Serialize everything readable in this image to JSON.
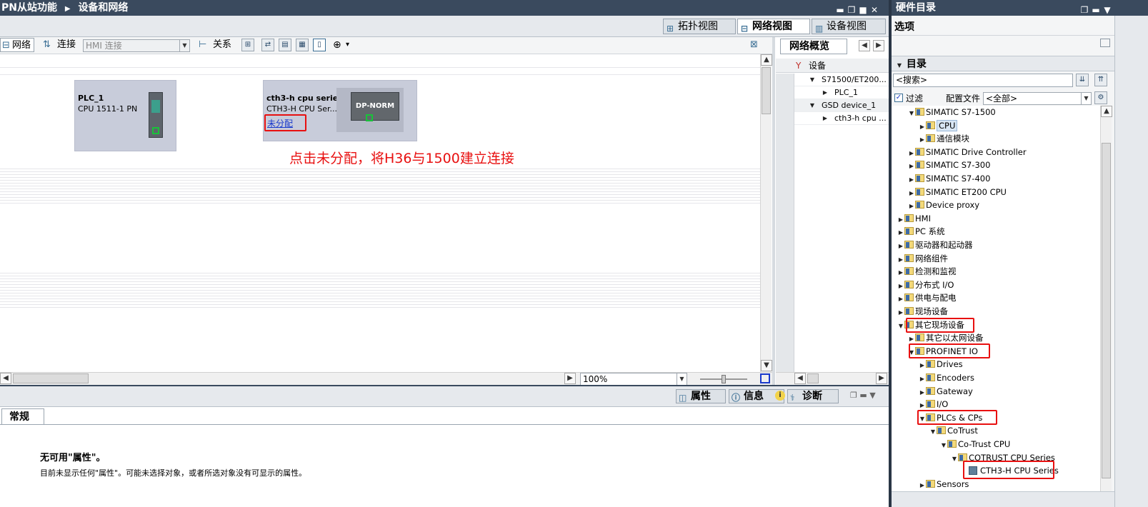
{
  "window": {
    "breadcrumb": [
      "PN从站功能",
      "设备和网络"
    ],
    "controls": [
      "minimize",
      "restore",
      "maximize",
      "close"
    ]
  },
  "view_tabs": [
    {
      "label": "拓扑视图",
      "icon": "topology-icon",
      "active": false
    },
    {
      "label": "网络视图",
      "icon": "network-icon",
      "active": true
    },
    {
      "label": "设备视图",
      "icon": "device-icon",
      "active": false
    }
  ],
  "toolbar": {
    "network_label": "网络",
    "connection_label": "连接",
    "connection_type_placeholder": "HMI 连接",
    "relation_label": "关系"
  },
  "devices": [
    {
      "name": "PLC_1",
      "type": "CPU 1511-1 PN"
    },
    {
      "name": "cth3-h cpu series",
      "type": "CTH3-H  CPU  Ser...",
      "link": "未分配",
      "module_label": "DP-NORM"
    }
  ],
  "annotation": {
    "text": "点击未分配，将H36与1500建立连接",
    "color": "#e81010"
  },
  "zoom": {
    "value": "100%"
  },
  "overview": {
    "tab_label": "网络概览",
    "header": "设备",
    "rows": [
      {
        "label": "S71500/ET200...",
        "level": 0,
        "expanded": true
      },
      {
        "label": "PLC_1",
        "level": 1,
        "expanded": false
      },
      {
        "label": "GSD device_1",
        "level": 0,
        "expanded": true
      },
      {
        "label": "cth3-h cpu ...",
        "level": 1,
        "expanded": false
      }
    ]
  },
  "properties": {
    "tabs": [
      "属性",
      "信息",
      "诊断"
    ],
    "general_tab": "常规",
    "title": "无可用\"属性\"。",
    "message": "目前未显示任何\"属性\"。可能未选择对象，或者所选对象没有可显示的属性。"
  },
  "catalog": {
    "title": "硬件目录",
    "options_label": "选项",
    "directory_label": "目录",
    "search_placeholder": "<搜索>",
    "filter_label": "过滤",
    "profile_label": "配置文件",
    "profile_value": "<全部>",
    "tree": [
      {
        "label": "SIMATIC S7-1500",
        "level": 1,
        "state": "expanded",
        "kind": "folder"
      },
      {
        "label": "CPU",
        "level": 2,
        "state": "collapsed",
        "kind": "folder",
        "selected": true
      },
      {
        "label": "通信模块",
        "level": 2,
        "state": "collapsed",
        "kind": "folder"
      },
      {
        "label": "SIMATIC Drive Controller",
        "level": 1,
        "state": "collapsed",
        "kind": "folder"
      },
      {
        "label": "SIMATIC S7-300",
        "level": 1,
        "state": "collapsed",
        "kind": "folder"
      },
      {
        "label": "SIMATIC S7-400",
        "level": 1,
        "state": "collapsed",
        "kind": "folder"
      },
      {
        "label": "SIMATIC ET200 CPU",
        "level": 1,
        "state": "collapsed",
        "kind": "folder"
      },
      {
        "label": "Device proxy",
        "level": 1,
        "state": "collapsed",
        "kind": "folder"
      },
      {
        "label": "HMI",
        "level": 0,
        "state": "collapsed",
        "kind": "folder"
      },
      {
        "label": "PC 系统",
        "level": 0,
        "state": "collapsed",
        "kind": "folder"
      },
      {
        "label": "驱动器和起动器",
        "level": 0,
        "state": "collapsed",
        "kind": "folder"
      },
      {
        "label": "网络组件",
        "level": 0,
        "state": "collapsed",
        "kind": "folder"
      },
      {
        "label": "检测和监视",
        "level": 0,
        "state": "collapsed",
        "kind": "folder"
      },
      {
        "label": "分布式 I/O",
        "level": 0,
        "state": "collapsed",
        "kind": "folder"
      },
      {
        "label": "供电与配电",
        "level": 0,
        "state": "collapsed",
        "kind": "folder"
      },
      {
        "label": "现场设备",
        "level": 0,
        "state": "collapsed",
        "kind": "folder"
      },
      {
        "label": "其它现场设备",
        "level": 0,
        "state": "expanded",
        "kind": "folder",
        "highlight": true
      },
      {
        "label": "其它以太网设备",
        "level": 1,
        "state": "collapsed",
        "kind": "folder"
      },
      {
        "label": "PROFINET IO",
        "level": 1,
        "state": "expanded",
        "kind": "folder",
        "highlight": true
      },
      {
        "label": "Drives",
        "level": 2,
        "state": "collapsed",
        "kind": "folder"
      },
      {
        "label": "Encoders",
        "level": 2,
        "state": "collapsed",
        "kind": "folder"
      },
      {
        "label": "Gateway",
        "level": 2,
        "state": "collapsed",
        "kind": "folder"
      },
      {
        "label": "I/O",
        "level": 2,
        "state": "collapsed",
        "kind": "folder"
      },
      {
        "label": "PLCs & CPs",
        "level": 2,
        "state": "expanded",
        "kind": "folder",
        "highlight": true
      },
      {
        "label": "CoTrust",
        "level": 3,
        "state": "expanded",
        "kind": "folder"
      },
      {
        "label": "Co-Trust CPU",
        "level": 4,
        "state": "expanded",
        "kind": "folder"
      },
      {
        "label": "COTRUST CPU Series",
        "level": 5,
        "state": "expanded",
        "kind": "folder"
      },
      {
        "label": "CTH3-H CPU Series",
        "level": 6,
        "state": "leaf",
        "kind": "device",
        "highlight": true
      },
      {
        "label": "Sensors",
        "level": 2,
        "state": "collapsed",
        "kind": "folder"
      }
    ]
  }
}
